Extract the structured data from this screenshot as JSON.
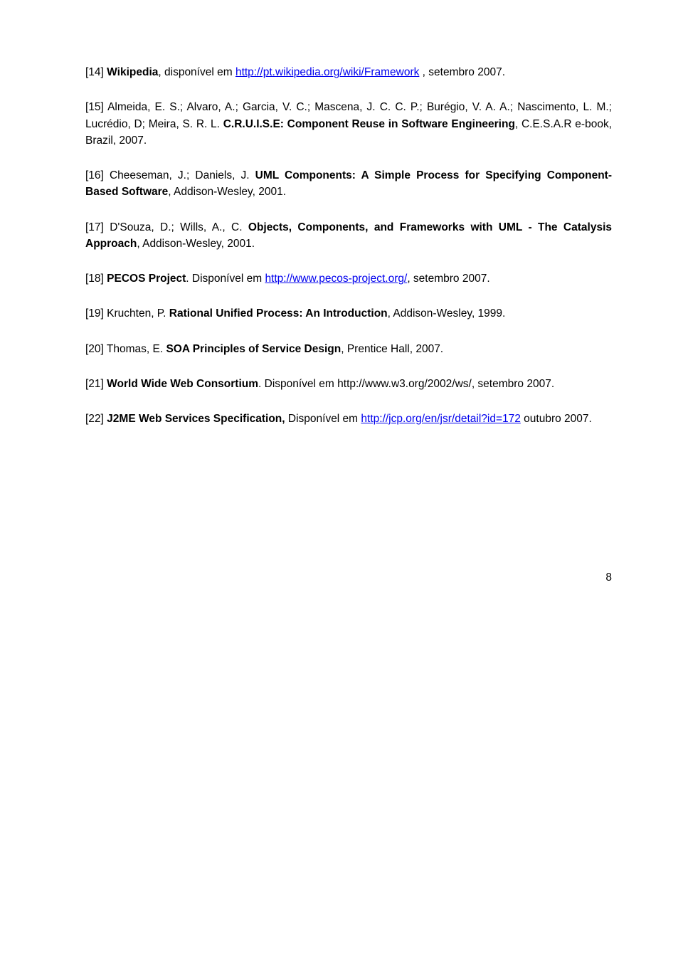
{
  "refs": {
    "r14": {
      "prefix": "[14] ",
      "title": "Wikipedia",
      "mid": ", disponível em ",
      "link": "http://pt.wikipedia.org/wiki/Framework",
      "suffix": " , setembro 2007."
    },
    "r15": {
      "line1_prefix": "[15] Almeida, E. S.; Alvaro, A.; Garcia, V. C.; Mascena, J. C. C. P.; Burégio, V. A. A.; Nascimento, L. M.; Lucrédio, D; Meira, S. R. L. ",
      "title": "C.R.U.I.S.E: Component Reuse in Software Engineering",
      "suffix": ", C.E.S.A.R e-book, Brazil, 2007."
    },
    "r16": {
      "prefix": "[16] Cheeseman, J.; Daniels, J. ",
      "title": "UML Components: A Simple Process for Specifying Component-Based Software",
      "suffix": ", Addison-Wesley, 2001."
    },
    "r17": {
      "prefix": "[17] D'Souza, D.; Wills, A., C. ",
      "title": "Objects, Components, and Frameworks with UML - The Catalysis Approach",
      "suffix": ", Addison-Wesley, 2001."
    },
    "r18": {
      "prefix": "[18] ",
      "title": "PECOS Project",
      "mid": ". Disponível em ",
      "link": "http://www.pecos-project.org/",
      "suffix": ", setembro 2007."
    },
    "r19": {
      "prefix": "[19] Kruchten, P. ",
      "title": "Rational Unified Process: An Introduction",
      "suffix": ", Addison-Wesley, 1999."
    },
    "r20": {
      "prefix": "[20] Thomas, E. ",
      "title": "SOA Principles of Service Design",
      "suffix": ", Prentice Hall, 2007."
    },
    "r21": {
      "prefix": "[21] ",
      "title": "World Wide Web Consortium",
      "suffix": ". Disponível em http://www.w3.org/2002/ws/, setembro 2007."
    },
    "r22": {
      "prefix": "[22] ",
      "title": "J2ME Web Services Specification,",
      "mid": " Disponível em ",
      "link": "http://jcp.org/en/jsr/detail?id=172",
      "suffix": " outubro 2007."
    }
  },
  "page_number": "8"
}
